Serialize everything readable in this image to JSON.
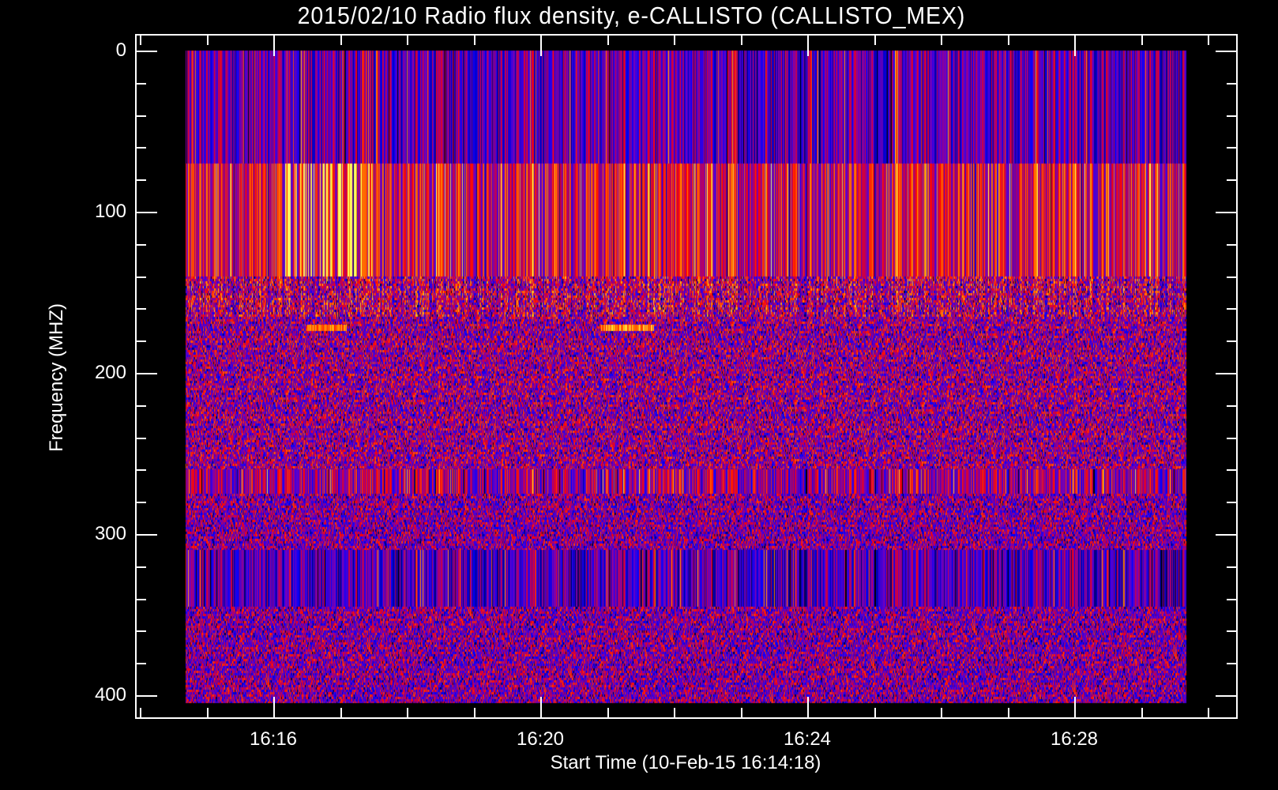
{
  "chart_data": {
    "type": "heatmap",
    "title": "2015/02/10  Radio flux density, e-CALLISTO (CALLISTO_MEX)",
    "xlabel": "Start Time (10-Feb-15 16:14:18)",
    "ylabel": "Frequency (MHZ)",
    "x_tick_labels": [
      "16:16",
      "16:20",
      "16:24",
      "16:28"
    ],
    "x_tick_minutes": [
      16,
      20,
      24,
      28
    ],
    "x_range_minutes_after_1600": [
      13.93,
      30.46
    ],
    "data_x_range_minutes_after_1600": [
      14.69,
      29.68
    ],
    "y_tick_labels": [
      "0",
      "100",
      "200",
      "300",
      "400"
    ],
    "y_tick_values": [
      0,
      100,
      200,
      300,
      400
    ],
    "y_range": [
      0,
      405
    ],
    "y_inverted": true,
    "colormap": [
      "#000000",
      "#0000ff",
      "#7000c0",
      "#ff0000",
      "#ffa000",
      "#ffff60"
    ],
    "bands": [
      {
        "fmin": 0,
        "fmax": 70,
        "style": "vertical-stripes",
        "level": 0.35
      },
      {
        "fmin": 70,
        "fmax": 140,
        "style": "vertical-stripes",
        "level": 0.55
      },
      {
        "fmin": 140,
        "fmax": 165,
        "style": "mixed",
        "level": 0.5
      },
      {
        "fmin": 165,
        "fmax": 260,
        "style": "noise",
        "level": 0.45
      },
      {
        "fmin": 260,
        "fmax": 275,
        "style": "vertical-stripes",
        "level": 0.45
      },
      {
        "fmin": 275,
        "fmax": 310,
        "style": "noise",
        "level": 0.42
      },
      {
        "fmin": 310,
        "fmax": 345,
        "style": "vertical-stripes",
        "level": 0.32
      },
      {
        "fmin": 345,
        "fmax": 405,
        "style": "noise",
        "level": 0.42
      }
    ],
    "bursts": [
      {
        "fmin": 70,
        "fmax": 140,
        "tmin": 16.15,
        "tmax": 17.5,
        "intensity": 1.0
      },
      {
        "fmin": 170,
        "fmax": 174,
        "tmin": 20.9,
        "tmax": 21.7,
        "intensity": 0.9
      },
      {
        "fmin": 170,
        "fmax": 174,
        "tmin": 16.5,
        "tmax": 17.1,
        "intensity": 0.7
      }
    ]
  }
}
